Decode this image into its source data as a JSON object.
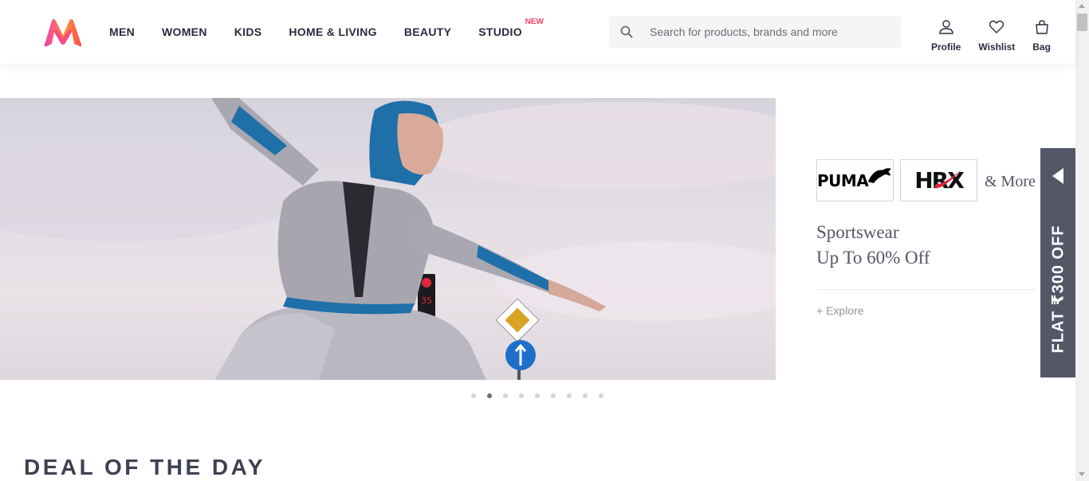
{
  "brand": {
    "name": "Myntra",
    "logo_icon": "myntra-m-logo",
    "accent": "#ff3f6c"
  },
  "nav": {
    "items": [
      {
        "label": "MEN"
      },
      {
        "label": "WOMEN"
      },
      {
        "label": "KIDS"
      },
      {
        "label": "HOME & LIVING"
      },
      {
        "label": "BEAUTY"
      },
      {
        "label": "STUDIO",
        "badge": "NEW"
      }
    ]
  },
  "search": {
    "placeholder": "Search for products, brands and more",
    "value": "",
    "icon": "search-icon"
  },
  "actions": {
    "profile": {
      "label": "Profile",
      "icon": "profile-icon"
    },
    "wishlist": {
      "label": "Wishlist",
      "icon": "heart-icon"
    },
    "bag": {
      "label": "Bag",
      "icon": "bag-icon"
    }
  },
  "banner": {
    "brands": [
      "PUMA",
      "HRX"
    ],
    "and_more": "& More",
    "headline_line1": "Sportswear",
    "headline_line2": "Up To 60% Off",
    "explore": "+ Explore",
    "dots_total": 9,
    "dots_active": 2,
    "traffic_light_number": "35"
  },
  "offer_tab": {
    "label": "FLAT ₹300 OFF",
    "color": "#535766"
  },
  "section": {
    "title": "DEAL OF THE DAY"
  }
}
